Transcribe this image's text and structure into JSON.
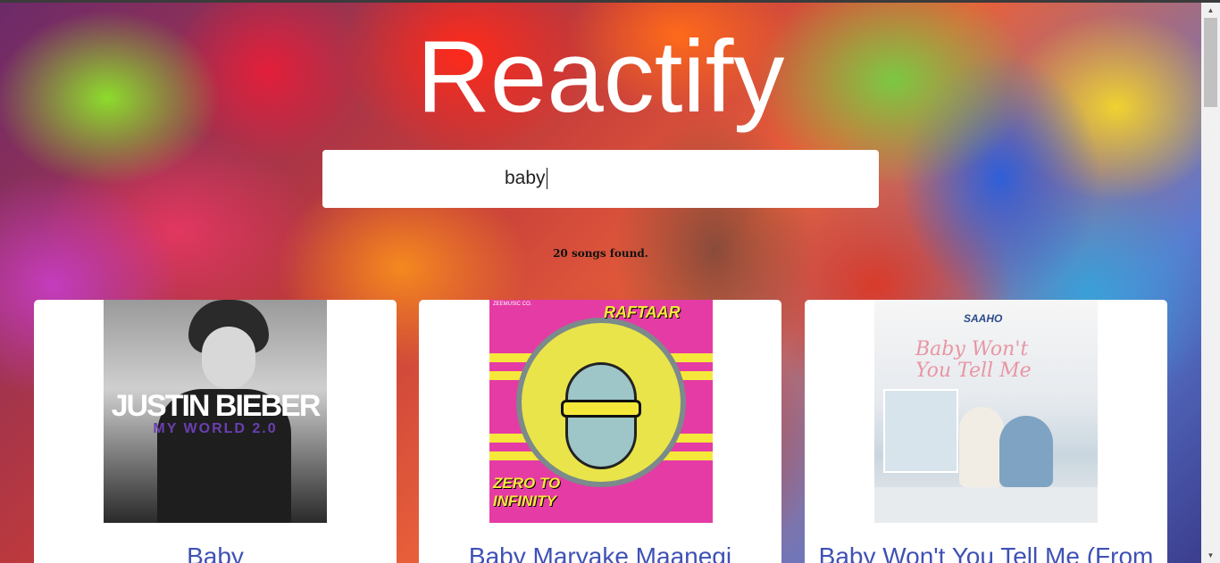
{
  "app": {
    "title": "Reactify"
  },
  "search": {
    "value": "baby",
    "placeholder": ""
  },
  "results": {
    "count_text": "20 songs found."
  },
  "songs": [
    {
      "title": "Baby",
      "art": {
        "artist_text": "JUSTIN BIEBER",
        "album_text": "MY WORLD 2.0"
      }
    },
    {
      "title": "Baby Maryake Maanegi",
      "art": {
        "artist_text": "RAFTAAR",
        "album_text": "ZERO TO INFINITY",
        "label_text": "ZEEMUSIC CO."
      }
    },
    {
      "title": "Baby Won't You Tell Me (From",
      "art": {
        "logo_text": "SAAHO",
        "script_text": "Baby Won't You Tell Me"
      }
    }
  ],
  "colors": {
    "title_text": "#ffffff",
    "song_title": "#3f51b5",
    "card_bg": "#ffffff"
  },
  "icons": {
    "scroll_up": "triangle-up",
    "scroll_down": "triangle-down"
  }
}
